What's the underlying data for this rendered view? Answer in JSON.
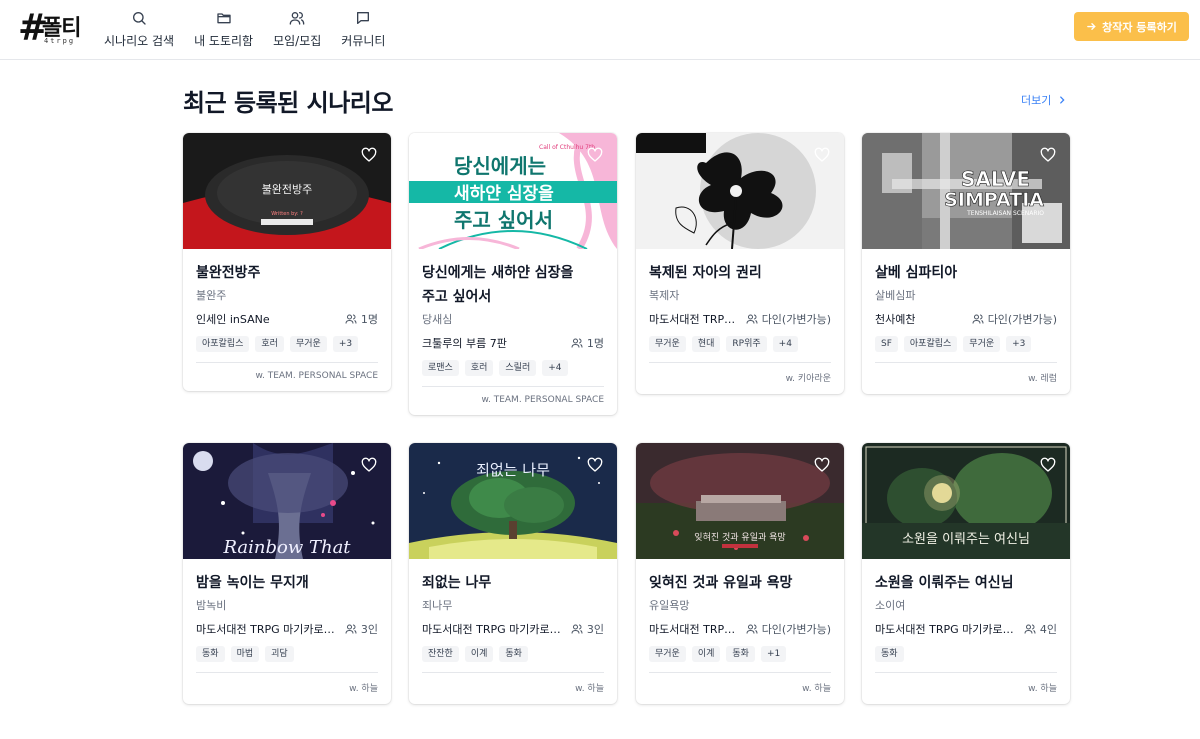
{
  "header": {
    "logo_text": "폴티",
    "logo_sub": "4trpg",
    "nav": [
      {
        "label": "시나리오 검색",
        "icon": "search-icon"
      },
      {
        "label": "내 도토리함",
        "icon": "folder-icon"
      },
      {
        "label": "모임/모집",
        "icon": "users-icon"
      },
      {
        "label": "커뮤니티",
        "icon": "chat-icon"
      }
    ],
    "cta_label": "창작자 등록하기"
  },
  "section": {
    "title": "최근 등록된 시나리오",
    "more_label": "더보기"
  },
  "cards": [
    {
      "title": "불완전방주",
      "subtitle": "불완주",
      "publisher": "인세인 inSANe",
      "players": "1명",
      "tags": [
        "아포칼립스",
        "호러",
        "무거운",
        "+3"
      ],
      "writer": "w. TEAM. PERSONAL SPACE"
    },
    {
      "title": "당신에게는 새하얀 심장을 주고 싶어서",
      "subtitle": "당새심",
      "publisher": "크툴루의 부름 7판",
      "players": "1명",
      "tags": [
        "로맨스",
        "호러",
        "스릴러",
        "+4"
      ],
      "writer": "w. TEAM. PERSONAL SPACE"
    },
    {
      "title": "복제된 자아의 권리",
      "subtitle": "복제자",
      "publisher": "마도서대전 TRP…",
      "players": "다인(가변가능)",
      "tags": [
        "무거운",
        "현대",
        "RP위주",
        "+4"
      ],
      "writer": "w. 키아라운"
    },
    {
      "title": "살베 심파티아",
      "subtitle": "살베심파",
      "publisher": "천사예찬",
      "players": "다인(가변가능)",
      "tags": [
        "SF",
        "아포칼립스",
        "무거운",
        "+3"
      ],
      "writer": "w. 레럼"
    },
    {
      "title": "밤을 녹이는 무지개",
      "subtitle": "밤녹비",
      "publisher": "마도서대전 TRPG 마기카로…",
      "players": "3인",
      "tags": [
        "동화",
        "마법",
        "괴담"
      ],
      "writer": "w. 하늘"
    },
    {
      "title": "죄없는 나무",
      "subtitle": "죄나무",
      "publisher": "마도서대전 TRPG 마기카로…",
      "players": "3인",
      "tags": [
        "잔잔한",
        "이계",
        "동화"
      ],
      "writer": "w. 하늘"
    },
    {
      "title": "잊혀진 것과 유일과 욕망",
      "subtitle": "유일욕망",
      "publisher": "마도서대전 TRP…",
      "players": "다인(가변가능)",
      "tags": [
        "무거운",
        "이계",
        "동화",
        "+1"
      ],
      "writer": "w. 하늘"
    },
    {
      "title": "소원을 이뤄주는 여신님",
      "subtitle": "소이여",
      "publisher": "마도서대전 TRPG 마기카로…",
      "players": "4인",
      "tags": [
        "동화"
      ],
      "writer": "w. 하늘"
    }
  ],
  "thumbs": [
    {
      "text": "불완전방주",
      "sub": "Written by: ?"
    },
    {
      "text": "당신에게는",
      "text2": "새하얀 심장을",
      "text3": "주고 싶어서",
      "sub": "Call of Cthulhu 7th"
    },
    {},
    {
      "text": "SALVE",
      "text2": "SIMPATIA",
      "sub": "TENSHILAISAN SCENARIO"
    },
    {
      "text": "Rainbow That"
    },
    {
      "text": "죄없는 나무"
    },
    {
      "text": "잊혀진 것과 유일과 욕망"
    },
    {
      "text": "소원을 이뤄주는 여신님"
    }
  ]
}
